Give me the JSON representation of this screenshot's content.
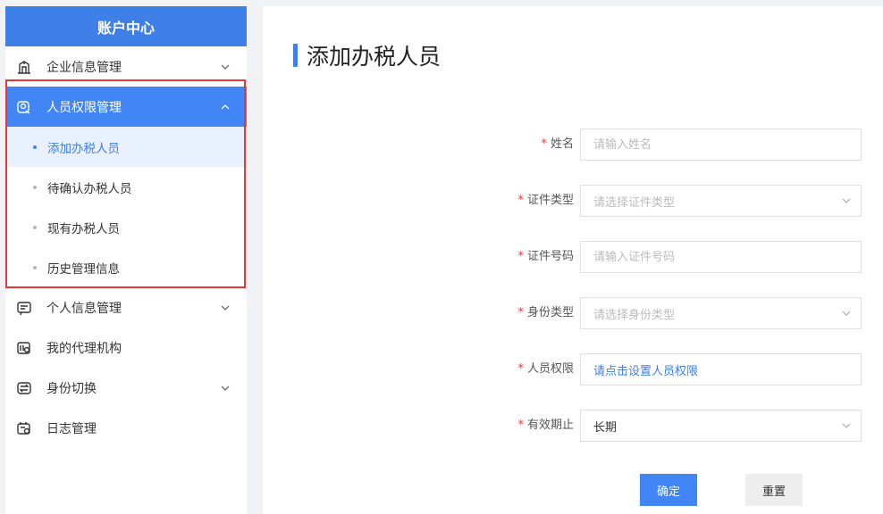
{
  "sidebar": {
    "title": "账户中心",
    "items": [
      {
        "label": "企业信息管理",
        "icon": "building-icon"
      },
      {
        "label": "人员权限管理",
        "icon": "user-search-icon"
      },
      {
        "label": "个人信息管理",
        "icon": "message-card-icon"
      },
      {
        "label": "我的代理机构",
        "icon": "agency-icon"
      },
      {
        "label": "身份切换",
        "icon": "switch-icon"
      },
      {
        "label": "日志管理",
        "icon": "calendar-log-icon"
      }
    ],
    "sub_items": [
      "添加办税人员",
      "待确认办税人员",
      "现有办税人员",
      "历史管理信息"
    ]
  },
  "page": {
    "title": "添加办税人员"
  },
  "form": {
    "name_label": "姓名",
    "name_placeholder": "请输入姓名",
    "id_type_label": "证件类型",
    "id_type_placeholder": "请选择证件类型",
    "id_number_label": "证件号码",
    "id_number_placeholder": "请输入证件号码",
    "identity_type_label": "身份类型",
    "identity_type_placeholder": "请选择身份类型",
    "permission_label": "人员权限",
    "permission_link": "请点击设置人员权限",
    "validity_label": "有效期止",
    "validity_value": "长期",
    "required_mark": "*"
  },
  "buttons": {
    "confirm": "确定",
    "reset": "重置"
  },
  "colors": {
    "accent": "#3f7fe8",
    "active_bg": "#4285f4",
    "required": "#e53935"
  }
}
